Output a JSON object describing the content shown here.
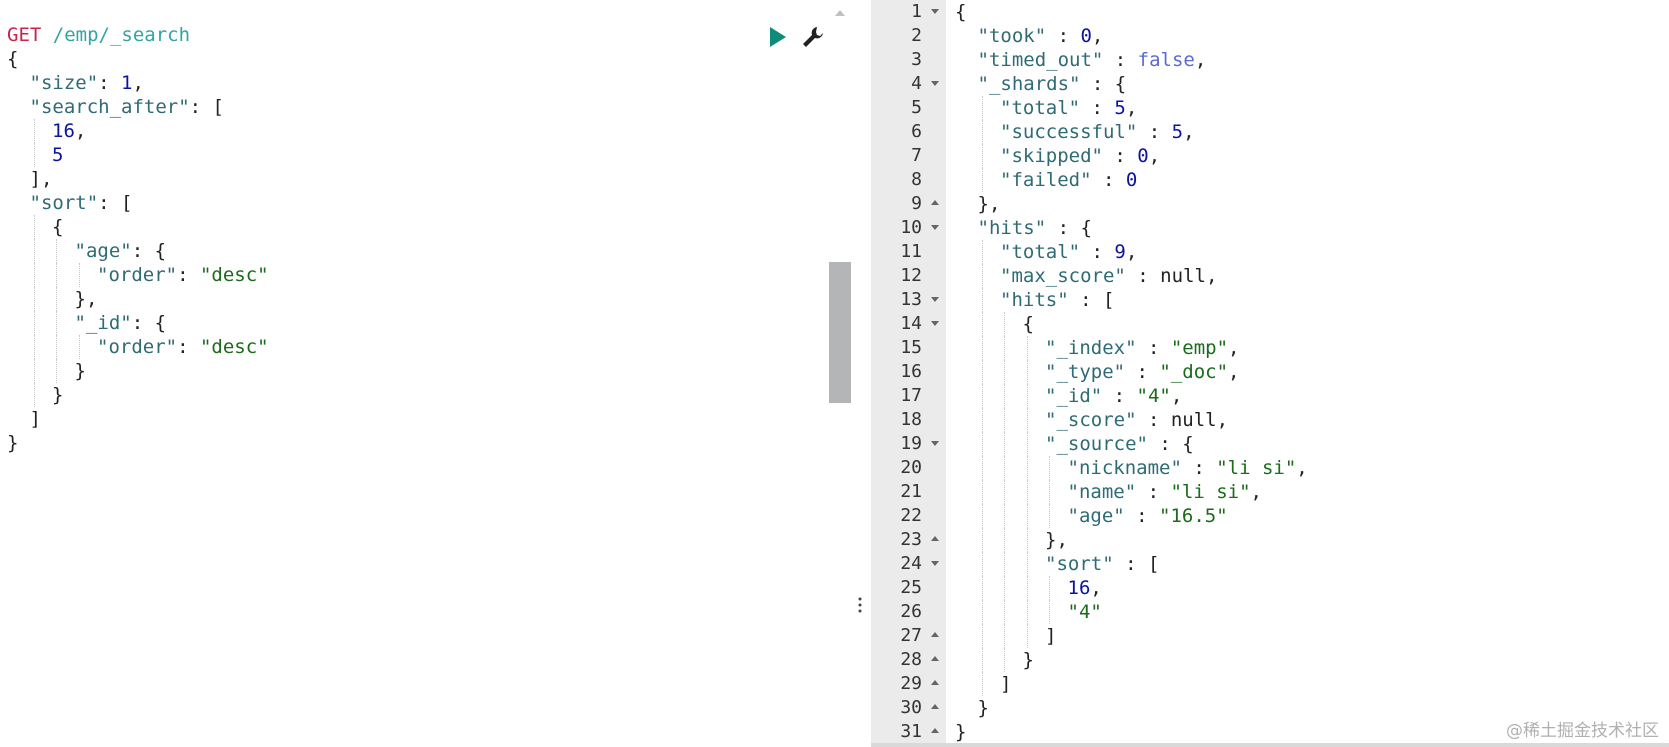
{
  "request": {
    "method": "GET",
    "url": "/emp/_search",
    "lines": [
      {
        "indent": 0,
        "tokens": [
          [
            "punc",
            "{"
          ]
        ]
      },
      {
        "indent": 1,
        "tokens": [
          [
            "key",
            "\"size\""
          ],
          [
            "punc",
            ": "
          ],
          [
            "num",
            "1"
          ],
          [
            "punc",
            ","
          ]
        ]
      },
      {
        "indent": 1,
        "tokens": [
          [
            "key",
            "\"search_after\""
          ],
          [
            "punc",
            ": ["
          ]
        ]
      },
      {
        "indent": 2,
        "tokens": [
          [
            "num",
            "16"
          ],
          [
            "punc",
            ","
          ]
        ]
      },
      {
        "indent": 2,
        "tokens": [
          [
            "num",
            "5"
          ]
        ]
      },
      {
        "indent": 1,
        "tokens": [
          [
            "punc",
            "],"
          ]
        ]
      },
      {
        "indent": 1,
        "tokens": [
          [
            "key",
            "\"sort\""
          ],
          [
            "punc",
            ": ["
          ]
        ]
      },
      {
        "indent": 2,
        "tokens": [
          [
            "punc",
            "{"
          ]
        ]
      },
      {
        "indent": 3,
        "tokens": [
          [
            "key",
            "\"age\""
          ],
          [
            "punc",
            ": {"
          ]
        ]
      },
      {
        "indent": 4,
        "tokens": [
          [
            "key",
            "\"order\""
          ],
          [
            "punc",
            ": "
          ],
          [
            "str",
            "\"desc\""
          ]
        ]
      },
      {
        "indent": 3,
        "tokens": [
          [
            "punc",
            "},"
          ]
        ]
      },
      {
        "indent": 3,
        "tokens": [
          [
            "key",
            "\"_id\""
          ],
          [
            "punc",
            ": {"
          ]
        ]
      },
      {
        "indent": 4,
        "tokens": [
          [
            "key",
            "\"order\""
          ],
          [
            "punc",
            ": "
          ],
          [
            "str",
            "\"desc\""
          ]
        ]
      },
      {
        "indent": 3,
        "tokens": [
          [
            "punc",
            "}"
          ]
        ]
      },
      {
        "indent": 2,
        "tokens": [
          [
            "punc",
            "}"
          ]
        ]
      },
      {
        "indent": 1,
        "tokens": [
          [
            "punc",
            "]"
          ]
        ]
      },
      {
        "indent": 0,
        "tokens": [
          [
            "punc",
            "}"
          ]
        ]
      }
    ]
  },
  "toolbar": {
    "run_icon": "play-icon",
    "settings_icon": "wrench-icon",
    "run_color": "#0f8b7a"
  },
  "response": {
    "lines": [
      {
        "n": "1",
        "fold": "open",
        "indent": 0,
        "tokens": [
          [
            "punc",
            "{"
          ]
        ]
      },
      {
        "n": "2",
        "fold": "",
        "indent": 1,
        "tokens": [
          [
            "key",
            "\"took\""
          ],
          [
            "punc",
            " : "
          ],
          [
            "num",
            "0"
          ],
          [
            "punc",
            ","
          ]
        ]
      },
      {
        "n": "3",
        "fold": "",
        "indent": 1,
        "tokens": [
          [
            "key",
            "\"timed_out\""
          ],
          [
            "punc",
            " : "
          ],
          [
            "bool",
            "false"
          ],
          [
            "punc",
            ","
          ]
        ]
      },
      {
        "n": "4",
        "fold": "open",
        "indent": 1,
        "tokens": [
          [
            "key",
            "\"_shards\""
          ],
          [
            "punc",
            " : {"
          ]
        ]
      },
      {
        "n": "5",
        "fold": "",
        "indent": 2,
        "tokens": [
          [
            "key",
            "\"total\""
          ],
          [
            "punc",
            " : "
          ],
          [
            "num",
            "5"
          ],
          [
            "punc",
            ","
          ]
        ]
      },
      {
        "n": "6",
        "fold": "",
        "indent": 2,
        "tokens": [
          [
            "key",
            "\"successful\""
          ],
          [
            "punc",
            " : "
          ],
          [
            "num",
            "5"
          ],
          [
            "punc",
            ","
          ]
        ]
      },
      {
        "n": "7",
        "fold": "",
        "indent": 2,
        "tokens": [
          [
            "key",
            "\"skipped\""
          ],
          [
            "punc",
            " : "
          ],
          [
            "num",
            "0"
          ],
          [
            "punc",
            ","
          ]
        ]
      },
      {
        "n": "8",
        "fold": "",
        "indent": 2,
        "tokens": [
          [
            "key",
            "\"failed\""
          ],
          [
            "punc",
            " : "
          ],
          [
            "num",
            "0"
          ]
        ]
      },
      {
        "n": "9",
        "fold": "close",
        "indent": 1,
        "tokens": [
          [
            "punc",
            "},"
          ]
        ]
      },
      {
        "n": "10",
        "fold": "open",
        "indent": 1,
        "tokens": [
          [
            "key",
            "\"hits\""
          ],
          [
            "punc",
            " : {"
          ]
        ]
      },
      {
        "n": "11",
        "fold": "",
        "indent": 2,
        "tokens": [
          [
            "key",
            "\"total\""
          ],
          [
            "punc",
            " : "
          ],
          [
            "num",
            "9"
          ],
          [
            "punc",
            ","
          ]
        ]
      },
      {
        "n": "12",
        "fold": "",
        "indent": 2,
        "tokens": [
          [
            "key",
            "\"max_score\""
          ],
          [
            "punc",
            " : "
          ],
          [
            "nul",
            "null"
          ],
          [
            "punc",
            ","
          ]
        ]
      },
      {
        "n": "13",
        "fold": "open",
        "indent": 2,
        "tokens": [
          [
            "key",
            "\"hits\""
          ],
          [
            "punc",
            " : ["
          ]
        ]
      },
      {
        "n": "14",
        "fold": "open",
        "indent": 3,
        "tokens": [
          [
            "punc",
            "{"
          ]
        ]
      },
      {
        "n": "15",
        "fold": "",
        "indent": 4,
        "tokens": [
          [
            "key",
            "\"_index\""
          ],
          [
            "punc",
            " : "
          ],
          [
            "str",
            "\"emp\""
          ],
          [
            "punc",
            ","
          ]
        ]
      },
      {
        "n": "16",
        "fold": "",
        "indent": 4,
        "tokens": [
          [
            "key",
            "\"_type\""
          ],
          [
            "punc",
            " : "
          ],
          [
            "str",
            "\"_doc\""
          ],
          [
            "punc",
            ","
          ]
        ]
      },
      {
        "n": "17",
        "fold": "",
        "indent": 4,
        "tokens": [
          [
            "key",
            "\"_id\""
          ],
          [
            "punc",
            " : "
          ],
          [
            "str",
            "\"4\""
          ],
          [
            "punc",
            ","
          ]
        ]
      },
      {
        "n": "18",
        "fold": "",
        "indent": 4,
        "tokens": [
          [
            "key",
            "\"_score\""
          ],
          [
            "punc",
            " : "
          ],
          [
            "nul",
            "null"
          ],
          [
            "punc",
            ","
          ]
        ]
      },
      {
        "n": "19",
        "fold": "open",
        "indent": 4,
        "tokens": [
          [
            "key",
            "\"_source\""
          ],
          [
            "punc",
            " : {"
          ]
        ]
      },
      {
        "n": "20",
        "fold": "",
        "indent": 5,
        "tokens": [
          [
            "key",
            "\"nickname\""
          ],
          [
            "punc",
            " : "
          ],
          [
            "str",
            "\"li si\""
          ],
          [
            "punc",
            ","
          ]
        ]
      },
      {
        "n": "21",
        "fold": "",
        "indent": 5,
        "tokens": [
          [
            "key",
            "\"name\""
          ],
          [
            "punc",
            " : "
          ],
          [
            "str",
            "\"li si\""
          ],
          [
            "punc",
            ","
          ]
        ]
      },
      {
        "n": "22",
        "fold": "",
        "indent": 5,
        "tokens": [
          [
            "key",
            "\"age\""
          ],
          [
            "punc",
            " : "
          ],
          [
            "str",
            "\"16.5\""
          ]
        ]
      },
      {
        "n": "23",
        "fold": "close",
        "indent": 4,
        "tokens": [
          [
            "punc",
            "},"
          ]
        ]
      },
      {
        "n": "24",
        "fold": "open",
        "indent": 4,
        "tokens": [
          [
            "key",
            "\"sort\""
          ],
          [
            "punc",
            " : ["
          ]
        ]
      },
      {
        "n": "25",
        "fold": "",
        "indent": 5,
        "tokens": [
          [
            "num",
            "16"
          ],
          [
            "punc",
            ","
          ]
        ]
      },
      {
        "n": "26",
        "fold": "",
        "indent": 5,
        "tokens": [
          [
            "str",
            "\"4\""
          ]
        ]
      },
      {
        "n": "27",
        "fold": "close",
        "indent": 4,
        "tokens": [
          [
            "punc",
            "]"
          ]
        ]
      },
      {
        "n": "28",
        "fold": "close",
        "indent": 3,
        "tokens": [
          [
            "punc",
            "}"
          ]
        ]
      },
      {
        "n": "29",
        "fold": "close",
        "indent": 2,
        "tokens": [
          [
            "punc",
            "]"
          ]
        ]
      },
      {
        "n": "30",
        "fold": "close",
        "indent": 1,
        "tokens": [
          [
            "punc",
            "}"
          ]
        ]
      },
      {
        "n": "31",
        "fold": "close",
        "indent": 0,
        "tokens": [
          [
            "punc",
            "}"
          ]
        ]
      }
    ]
  },
  "watermark": "@稀土掘金技术社区"
}
